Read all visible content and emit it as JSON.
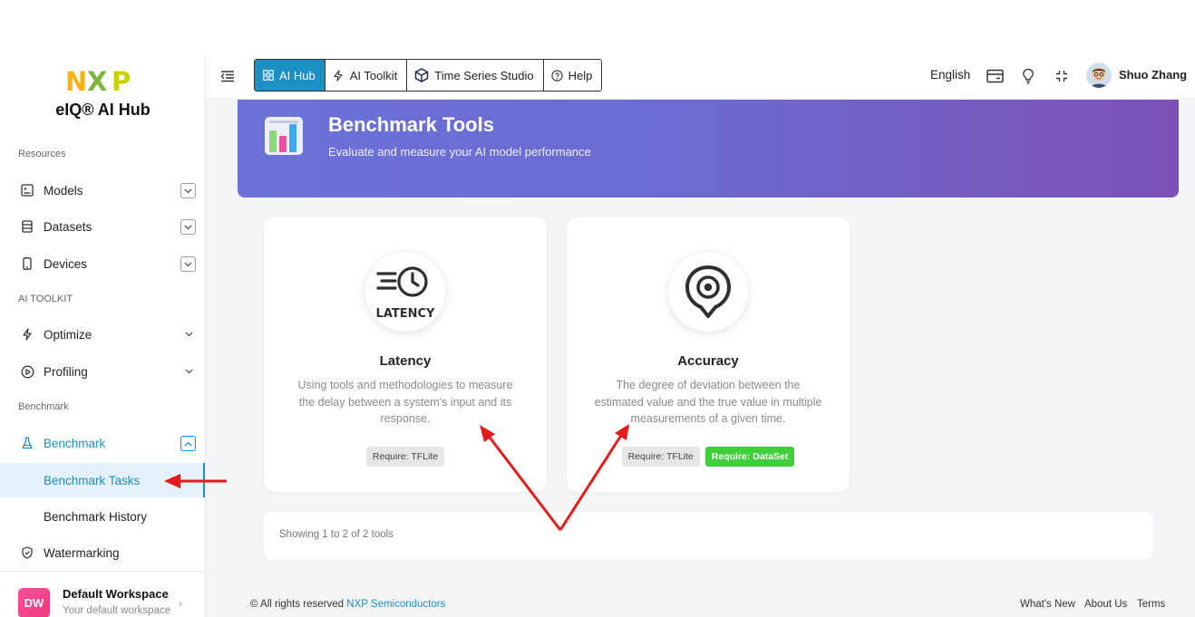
{
  "brand": {
    "logo_text": "NXP",
    "app_name": "eIQ® AI Hub"
  },
  "sidebar": {
    "sections": {
      "resources": "Resources",
      "ai_toolkit": "AI TOOLKIT",
      "benchmark": "Benchmark"
    },
    "items": {
      "models": "Models",
      "datasets": "Datasets",
      "devices": "Devices",
      "optimize": "Optimize",
      "profiling": "Profiling",
      "benchmark": "Benchmark",
      "benchmark_tasks": "Benchmark Tasks",
      "benchmark_history": "Benchmark History",
      "watermarking": "Watermarking"
    },
    "workspace": {
      "initials": "DW",
      "name": "Default Workspace",
      "subtitle": "Your default workspace"
    }
  },
  "topbar": {
    "tabs": [
      "AI Hub",
      "AI Toolkit",
      "Time Series Studio",
      "Help"
    ],
    "active_tab": "AI Hub",
    "language": "English",
    "user_name": "Shuo Zhang"
  },
  "banner": {
    "title": "Benchmark Tools",
    "subtitle": "Evaluate and measure your AI model performance"
  },
  "cards": [
    {
      "icon": "latency-clock-icon",
      "icon_caption": "LATENCY",
      "title": "Latency",
      "description": "Using tools and methodologies to measure the delay between a system's input and its response.",
      "badges": [
        "Require: TFLite"
      ]
    },
    {
      "icon": "accuracy-target-icon",
      "title": "Accuracy",
      "description": "The degree of deviation between the estimated value and the true value in multiple measurements of a given time.",
      "badges": [
        "Require: TFLite",
        "Require: DataSet"
      ]
    }
  ],
  "pagination": {
    "text": "Showing 1 to 2 of 2 tools"
  },
  "footer": {
    "copyright_prefix": "© All rights reserved ",
    "company": "NXP Semiconductors",
    "links": [
      "What's New",
      "About Us",
      "Terms"
    ]
  },
  "colors": {
    "accent": "#1c8fc4",
    "banner_start": "#6a72d8",
    "banner_end": "#7c51b6",
    "badge_green": "#3fcf3a",
    "annotation_red": "#e31b1b"
  }
}
